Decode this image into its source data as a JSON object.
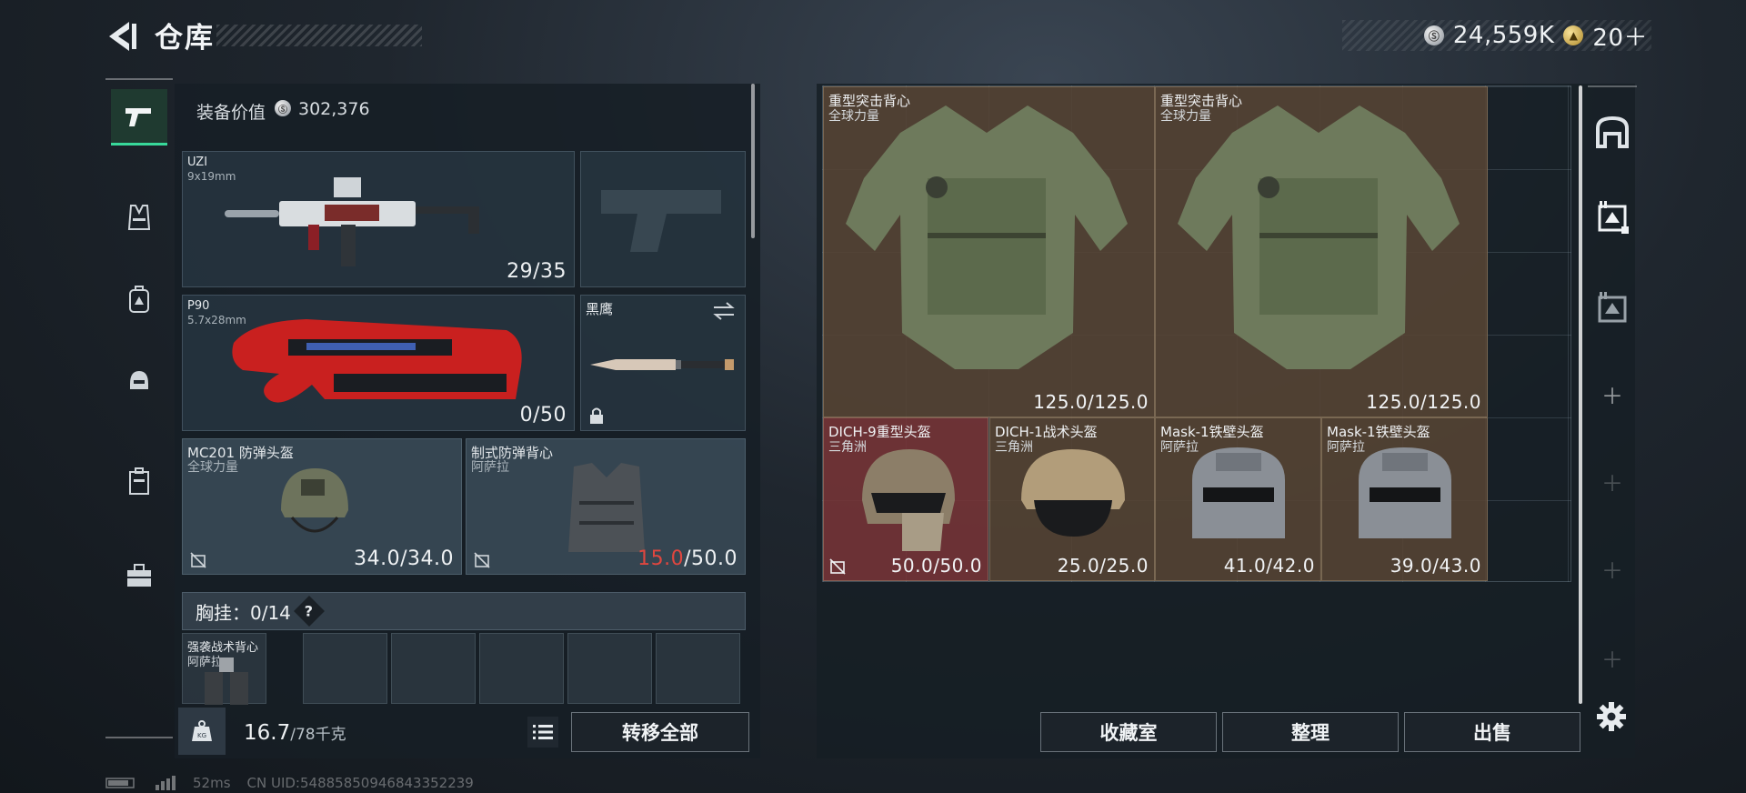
{
  "header": {
    "title": "仓库"
  },
  "currency": [
    {
      "icon": "silver-coin-icon",
      "value": "24,559K"
    },
    {
      "icon": "gold-token-icon",
      "value": "20＋"
    }
  ],
  "left_rail": [
    {
      "icon": "pistol-icon",
      "active": true
    },
    {
      "icon": "vest-icon",
      "active": false
    },
    {
      "icon": "backpack-icon",
      "active": false
    },
    {
      "icon": "helmet-icon",
      "active": false
    },
    {
      "icon": "case-icon",
      "active": false
    },
    {
      "icon": "toolbox-icon",
      "active": false
    }
  ],
  "equipment": {
    "value_label": "装备价值",
    "value": "302,376",
    "primary": {
      "name": "UZI",
      "caliber": "9x19mm",
      "ammo": "29/35"
    },
    "secondary": {
      "name": "P90",
      "caliber": "5.7x28mm",
      "ammo": "0/50"
    },
    "melee": {
      "name": "黑鹰"
    },
    "helmet": {
      "name": "MC201 防弹头盔",
      "faction": "全球力量",
      "durability": "34.0/34.0"
    },
    "armor": {
      "name": "制式防弹背心",
      "faction": "阿萨拉",
      "durability_current": "15.0",
      "durability_max": "/50.0"
    },
    "chest": {
      "label": "胸挂：0/14",
      "help": "?",
      "first_slot_name": "强袭战术背心",
      "first_slot_faction": "阿萨拉"
    },
    "weight": {
      "value": "16.7",
      "max": "/78千克"
    },
    "transfer_all": "转移全部"
  },
  "inventory": [
    {
      "name": "重型突击背心",
      "sub": "全球力量",
      "count": "125.0/125.0",
      "color": "brown"
    },
    {
      "name": "重型突击背心",
      "sub": "全球力量",
      "count": "125.0/125.0",
      "color": "brown"
    },
    {
      "name": "DICH-9重型头盔",
      "sub": "三角洲",
      "count": "50.0/50.0",
      "color": "red"
    },
    {
      "name": "DICH-1战术头盔",
      "sub": "三角洲",
      "count": "25.0/25.0",
      "color": "brown"
    },
    {
      "name": "Mask-1铁壁头盔",
      "sub": "阿萨拉",
      "count": "41.0/42.0",
      "color": "brown"
    },
    {
      "name": "Mask-1铁壁头盔",
      "sub": "阿萨拉",
      "count": "39.0/43.0",
      "color": "brown"
    }
  ],
  "buttons": {
    "collection": "收藏室",
    "organize": "整理",
    "sell": "出售"
  },
  "status": {
    "ping": "52ms",
    "uid": "CN UID:5488585094684335223​9"
  },
  "colors": {
    "accent": "#38d99a",
    "low_durability": "#e0463f",
    "item_brown": "#56443a"
  }
}
